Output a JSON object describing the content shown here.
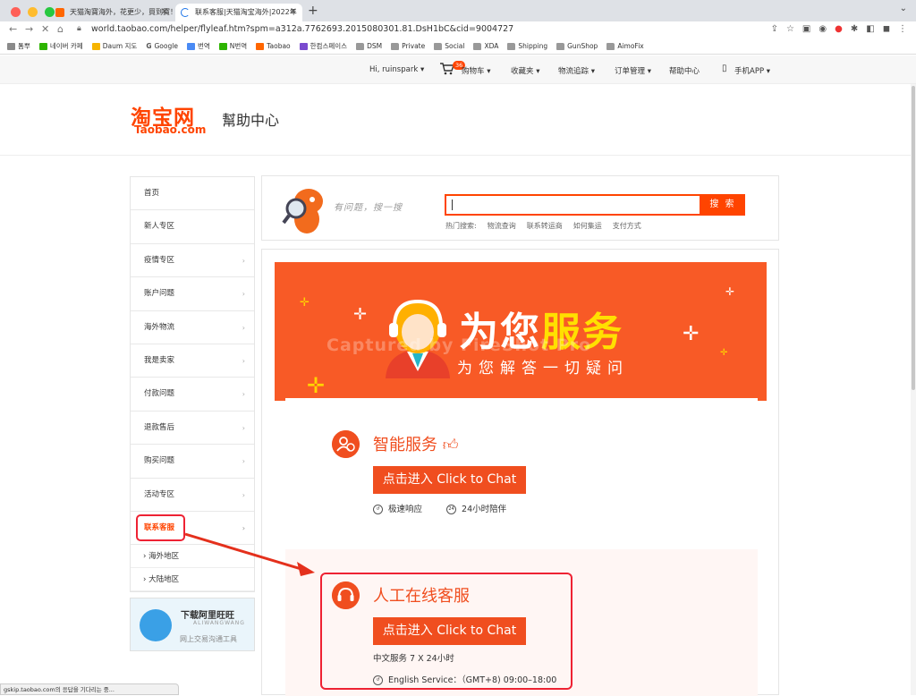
{
  "browser": {
    "tabs": [
      {
        "label": "天猫淘寶海外，花更少，買到寶！"
      },
      {
        "label": "联系客服|天猫淘宝海外|2022年"
      }
    ],
    "new_tab": "+",
    "url": "world.taobao.com/helper/flyleaf.htm?spm=a312a.7762693.2015080301.81.DsH1bC&cid=9004727",
    "bookmarks": [
      "톰뿌",
      "네이버 카페",
      "Daum 지도",
      "Google",
      "번역",
      "N번역",
      "Taobao",
      "한컴스페이스",
      "DSM",
      "Private",
      "Social",
      "XDA",
      "Shipping",
      "GunShop",
      "AimoFix"
    ],
    "status_text": "gskip.taobao.com의 응답을 기다리는 중..."
  },
  "topbar": {
    "greeting": "Hi, ruinspark ▾",
    "cart_count": "36",
    "cart": "购物车 ▾",
    "favorites": "收藏夹 ▾",
    "tracking": "物流追踪 ▾",
    "orders": "订单管理 ▾",
    "help": "帮助中心",
    "app": "手机APP ▾"
  },
  "header": {
    "logo_cn": "淘宝网",
    "logo_en": "Taobao.com",
    "title": "幫助中心"
  },
  "sidebar": {
    "items": [
      {
        "label": "首页",
        "arrow": ""
      },
      {
        "label": "新人专区",
        "arrow": ""
      },
      {
        "label": "疫情专区",
        "arrow": "›"
      },
      {
        "label": "账户问题",
        "arrow": "›"
      },
      {
        "label": "海外物流",
        "arrow": "›"
      },
      {
        "label": "我是卖家",
        "arrow": "›"
      },
      {
        "label": "付款问题",
        "arrow": "›"
      },
      {
        "label": "退款售后",
        "arrow": "›"
      },
      {
        "label": "购买问题",
        "arrow": "›"
      },
      {
        "label": "活动专区",
        "arrow": "›"
      },
      {
        "label": "联系客服",
        "arrow": "›"
      }
    ],
    "sub": [
      "› 海外地区",
      "› 大陆地区"
    ],
    "wangwang": {
      "title": "下载阿里旺旺",
      "latin": "ALIWANGWANG",
      "subtitle": "网上交易沟通工具"
    }
  },
  "search": {
    "ask_text": "有问题，搜一搜",
    "button": "搜 索",
    "hot_label": "热门搜索:",
    "hot": [
      "物流查询",
      "联系转运商",
      "如何集运",
      "支付方式"
    ]
  },
  "banner": {
    "title_white": "为您",
    "title_yellow": "服务",
    "subtitle": "为您解答一切疑问",
    "watermark": "Captured by FireShot Pro"
  },
  "services": [
    {
      "title": "智能服务",
      "button": "点击进入 Click to Chat",
      "feature1": "极速响应",
      "feature2": "24小时陪伴",
      "feature2_icon": "24"
    },
    {
      "title": "人工在线客服",
      "button": "点击进入 Click to Chat",
      "line1": "中文服务 7 X 24小时",
      "line2": "English Service：（GMT+8) 09:00–18:00"
    }
  ]
}
